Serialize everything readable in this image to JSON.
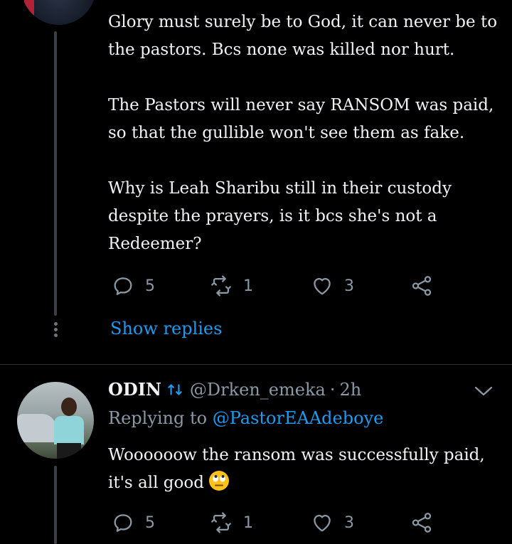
{
  "tweet1": {
    "text": "Glory must surely be to God, it can never be to\nthe pastors. Bcs none was killed nor hurt.\n\nThe Pastors will never say RANSOM was paid,\nso that the gullible won't see them as fake.\n\nWhy is Leah Sharibu still in their custody\ndespite the prayers, is it bcs she's not a\nRedeemer?",
    "reply_count": "5",
    "retweet_count": "1",
    "like_count": "3"
  },
  "thread": {
    "show_replies_label": "Show replies"
  },
  "tweet2": {
    "display_name": "ODIN",
    "handle": "@Drken_emeka",
    "separator": "·",
    "time": "2h",
    "replying_prefix": "Replying to ",
    "replying_to": "@PastorEAAdeboye",
    "text": "Woooooow the ransom was successfully paid,\nit's all good",
    "emoji": "face-with-rolling-eyes",
    "reply_count": "5",
    "retweet_count": "1",
    "like_count": "3"
  },
  "icons": {
    "reply": "reply-icon",
    "retweet": "retweet-icon",
    "like": "heart-icon",
    "share": "share-icon",
    "more": "chevron-down-icon"
  },
  "colors": {
    "background": "#000000",
    "accent": "#1d9bf0",
    "muted": "#8b98a5",
    "text": "#f0f2f4"
  }
}
